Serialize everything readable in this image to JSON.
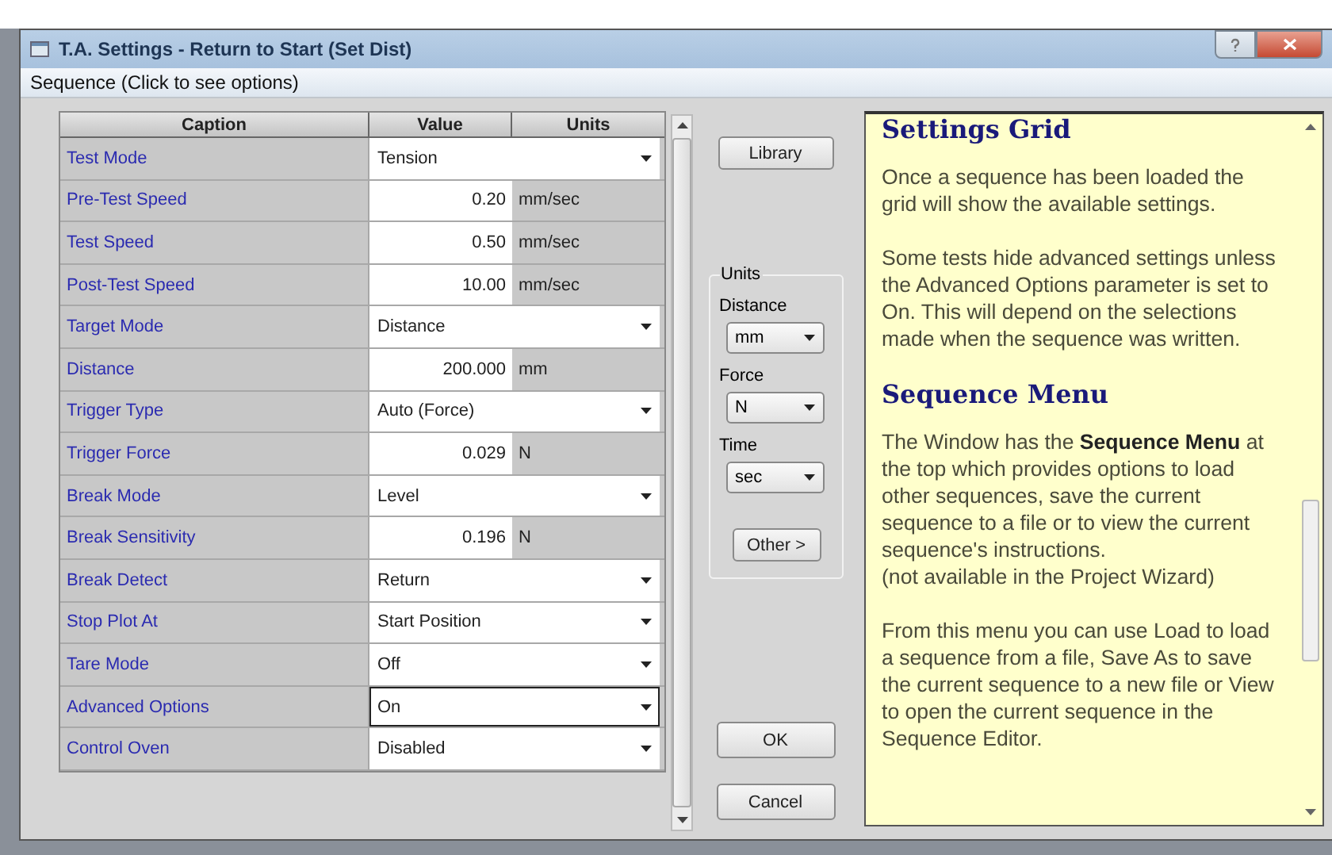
{
  "window": {
    "title": "T.A. Settings - Return to Start (Set Dist)"
  },
  "menu": {
    "label": "Sequence (Click to see options)"
  },
  "grid": {
    "columns": [
      "Caption",
      "Value",
      "Units"
    ],
    "rows": [
      {
        "caption": "Test Mode",
        "kind": "dropdown",
        "value": "Tension",
        "focused": false
      },
      {
        "caption": "Pre-Test Speed",
        "kind": "number",
        "value": "0.20",
        "units": "mm/sec"
      },
      {
        "caption": "Test Speed",
        "kind": "number",
        "value": "0.50",
        "units": "mm/sec"
      },
      {
        "caption": "Post-Test Speed",
        "kind": "number",
        "value": "10.00",
        "units": "mm/sec"
      },
      {
        "caption": "Target Mode",
        "kind": "dropdown",
        "value": "Distance",
        "focused": false
      },
      {
        "caption": "Distance",
        "kind": "number",
        "value": "200.000",
        "units": "mm"
      },
      {
        "caption": "Trigger Type",
        "kind": "dropdown",
        "value": "Auto (Force)",
        "focused": false
      },
      {
        "caption": "Trigger Force",
        "kind": "number",
        "value": "0.029",
        "units": "N"
      },
      {
        "caption": "Break Mode",
        "kind": "dropdown",
        "value": "Level",
        "focused": false
      },
      {
        "caption": "Break Sensitivity",
        "kind": "number",
        "value": "0.196",
        "units": "N"
      },
      {
        "caption": "Break Detect",
        "kind": "dropdown",
        "value": "Return",
        "focused": false
      },
      {
        "caption": "Stop Plot At",
        "kind": "dropdown",
        "value": "Start Position",
        "focused": false
      },
      {
        "caption": "Tare Mode",
        "kind": "dropdown",
        "value": "Off",
        "focused": false
      },
      {
        "caption": "Advanced Options",
        "kind": "dropdown",
        "value": "On",
        "focused": true
      },
      {
        "caption": "Control Oven",
        "kind": "dropdown",
        "value": "Disabled",
        "focused": false
      }
    ]
  },
  "library_button": "Library",
  "units": {
    "title": "Units",
    "fields": [
      {
        "label": "Distance",
        "value": "mm"
      },
      {
        "label": "Force",
        "value": "N"
      },
      {
        "label": "Time",
        "value": "sec"
      }
    ],
    "other_button": "Other >"
  },
  "buttons": [
    "OK",
    "Cancel"
  ],
  "help": [
    {
      "kind": "heading",
      "text": "Settings Grid"
    },
    {
      "kind": "paragraph",
      "text": "Once a sequence has been loaded the grid will show the available settings."
    },
    {
      "kind": "paragraph",
      "text": "Some tests hide advanced settings unless the Advanced Options parameter is set to On. This will depend on the selections made when the sequence was written."
    },
    {
      "kind": "heading",
      "text": "Sequence Menu"
    },
    {
      "kind": "paragraph",
      "text": "The Window has the **Sequence Menu** at the top which provides options to load other sequences, save the current sequence to a file or to view the current sequence's instructions."
    },
    {
      "kind": "note",
      "text": "(not available in the Project Wizard)"
    },
    {
      "kind": "paragraph",
      "text": "From this menu you can use Load to load a sequence from a file, Save As to save the current sequence to a new file or View to open the current sequence in the Sequence Editor."
    }
  ]
}
